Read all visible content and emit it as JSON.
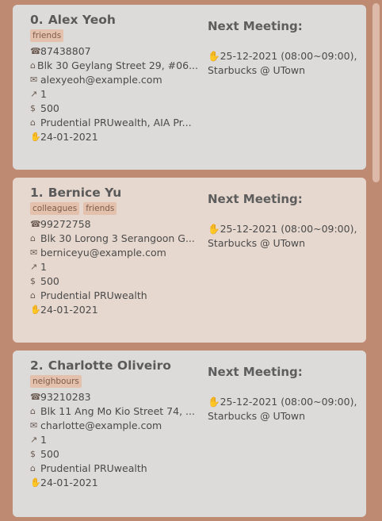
{
  "section_title": "Next Meeting:",
  "persons": [
    {
      "index": "0.",
      "name": "Alex Yeoh",
      "tags": [
        "friends"
      ],
      "phone": "87438807",
      "address": "Blk 30 Geylang Street 29, #06...",
      "email": "alexyeoh@example.com",
      "risk": "1",
      "income": "500",
      "policies": "Prudential PRUwealth, AIA Pr...",
      "date": "24-01-2021",
      "meeting_time": "25-12-2021 (08:00~09:00),",
      "meeting_place": "Starbucks @ UTown"
    },
    {
      "index": "1.",
      "name": "Bernice Yu",
      "tags": [
        "colleagues",
        "friends"
      ],
      "phone": "99272758",
      "address": "Blk 30 Lorong 3 Serangoon G...",
      "email": "berniceyu@example.com",
      "risk": "1",
      "income": "500",
      "policies": "Prudential PRUwealth",
      "date": "24-01-2021",
      "meeting_time": "25-12-2021 (08:00~09:00),",
      "meeting_place": "Starbucks @ UTown"
    },
    {
      "index": "2.",
      "name": "Charlotte Oliveiro",
      "tags": [
        "neighbours"
      ],
      "phone": "93210283",
      "address": "Blk 11 Ang Mo Kio Street 74, ...",
      "email": "charlotte@example.com",
      "risk": "1",
      "income": "500",
      "policies": "Prudential PRUwealth",
      "date": "24-01-2021",
      "meeting_time": "25-12-2021 (08:00~09:00),",
      "meeting_place": "Starbucks @ UTown"
    }
  ],
  "icons": {
    "phone": "phone-icon",
    "address": "house-icon",
    "email": "envelope-icon",
    "risk": "chart-icon",
    "income": "money-bag-icon",
    "policies": "bank-icon",
    "date": "handshake-icon",
    "meeting": "handshake-icon"
  }
}
